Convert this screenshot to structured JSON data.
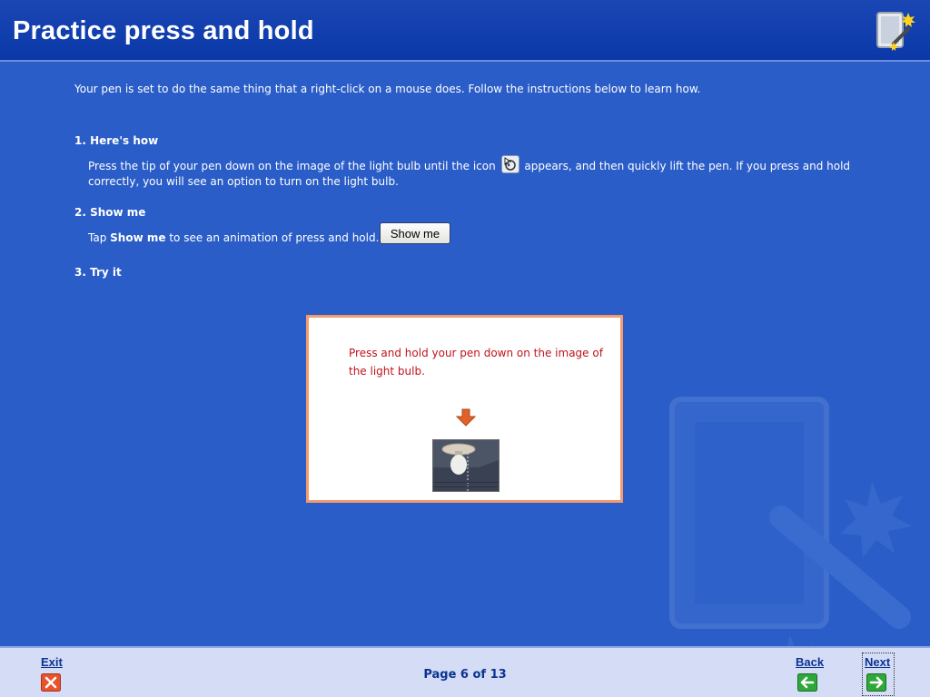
{
  "header": {
    "title": "Practice press and hold",
    "icon": "tablet-pen-icon"
  },
  "intro": "Your pen is set to do the same thing that a right-click on a mouse does. Follow the instructions below to learn how.",
  "step1": {
    "heading": "1. Here's how",
    "body_before_icon": "Press the tip of your pen down on the image of the light bulb until the icon",
    "icon": "press-and-hold-cursor-icon",
    "body_after_icon": "appears, and then quickly lift the pen. If you press and hold correctly, you will see an option to turn on the light bulb."
  },
  "step2": {
    "heading": "2. Show me",
    "body_prefix": "Tap",
    "body_bold": "Show me",
    "body_suffix": "to see an animation of press and hold.",
    "button_label": "Show me"
  },
  "step3": {
    "heading": "3. Try it",
    "instruction": "Press and hold your pen down on the image of the light bulb."
  },
  "footer": {
    "exit_label": "Exit",
    "back_label": "Back",
    "next_label": "Next",
    "page_indicator": "Page 6 of 13"
  },
  "colors": {
    "background": "#2a5dc7",
    "header": "#0b38a8",
    "footer": "#d4dcf6",
    "panel_border": "#f59a6a",
    "panel_text": "#c0141a"
  }
}
